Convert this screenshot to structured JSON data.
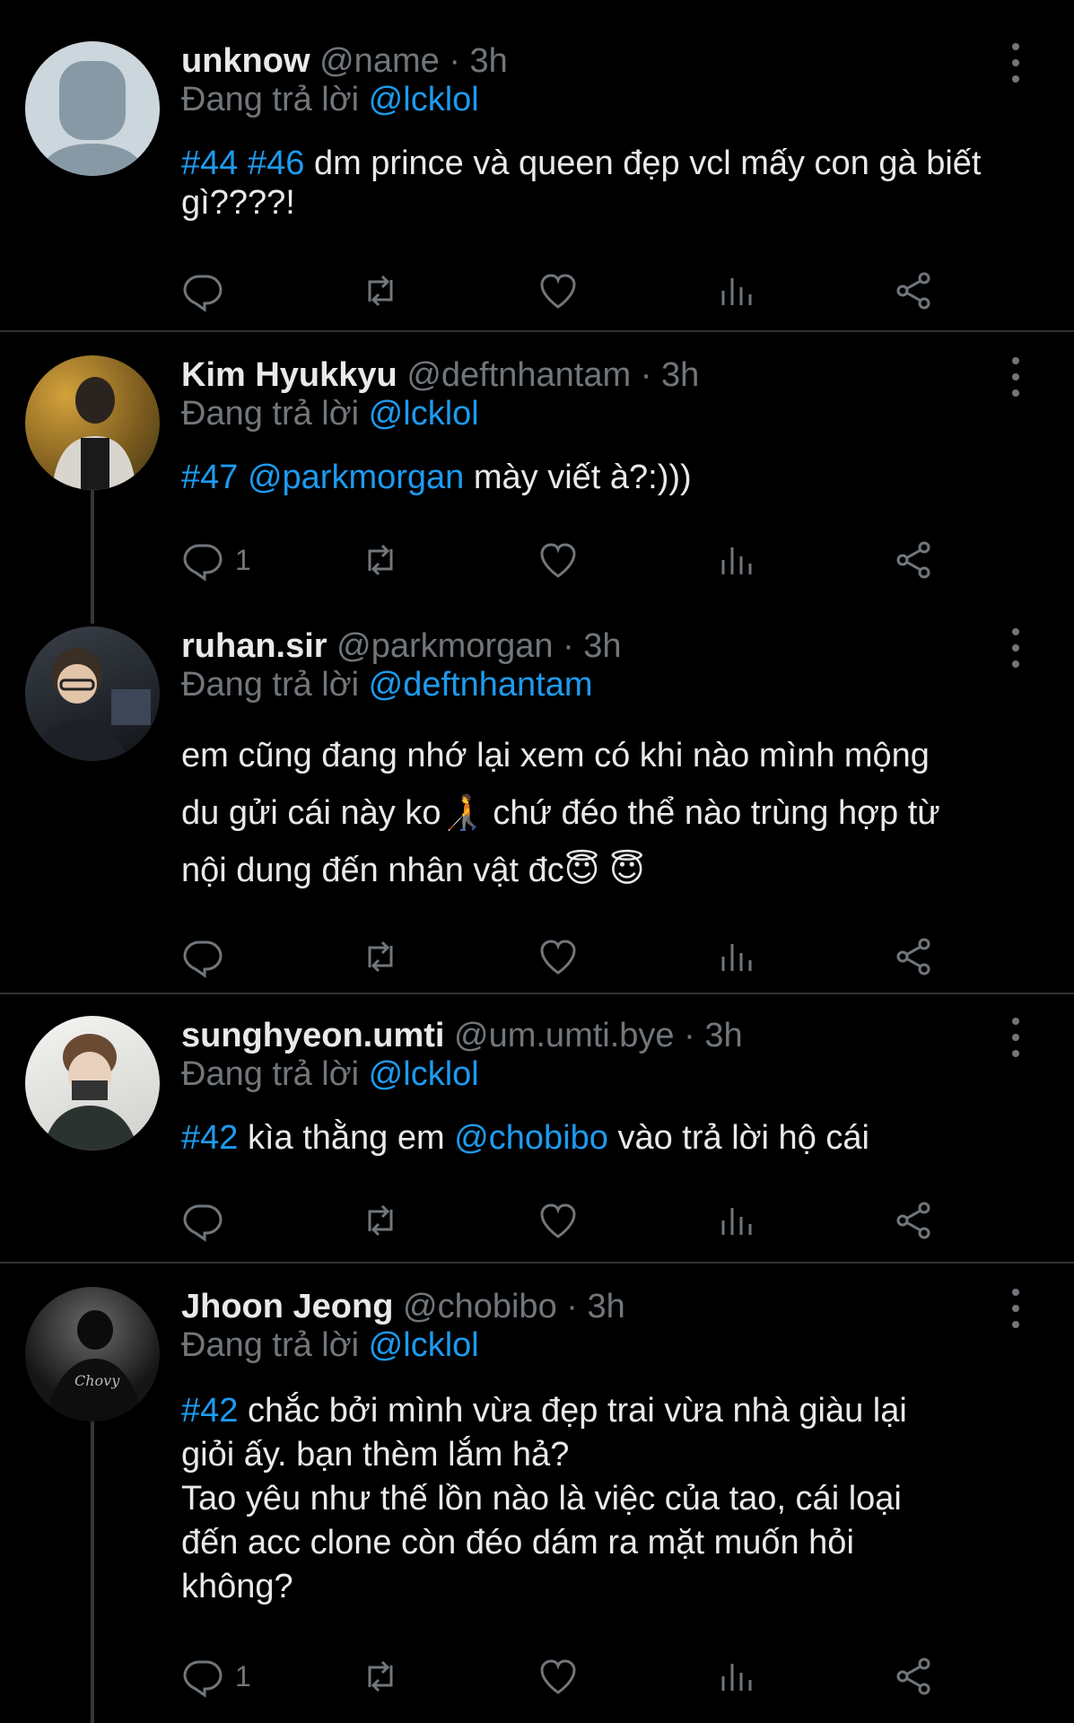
{
  "ui": {
    "replying_prefix": "Đang trả lời",
    "dot": "·"
  },
  "tweets": [
    {
      "name": "unknow",
      "handle": "@name",
      "time": "3h",
      "reply_to": "@lcklol",
      "tags": [
        "#44",
        "#46"
      ],
      "text": "dm prince và queen đẹp vcl mấy con gà biết gì????!",
      "reply_count": "",
      "avatar": "default-profile"
    },
    {
      "name": "Kim Hyukkyu",
      "handle": "@deftnhantam",
      "time": "3h",
      "reply_to": "@lcklol",
      "tags": [
        "#47"
      ],
      "mention": "@parkmorgan",
      "text": "mày viết à?:)))",
      "reply_count": "1",
      "avatar": "photo-autumn"
    },
    {
      "name": "ruhan.sir",
      "handle": "@parkmorgan",
      "time": "3h",
      "reply_to": "@deftnhantam",
      "line1": "em cũng đang nhớ lại xem có khi nào mình mộng",
      "line2": "du gửi cái này ko🧑‍🦯  chứ đéo thể nào trùng hợp từ",
      "line3": "nội dung đến nhân vật đc😇 😇",
      "reply_count": "",
      "avatar": "photo-gamer"
    },
    {
      "name": "sunghyeon.umti",
      "handle": "@um.umti.bye",
      "time": "3h",
      "reply_to": "@lcklol",
      "tags": [
        "#42"
      ],
      "pre": "kìa thằng em",
      "mention": "@chobibo",
      "post": "vào trả lời hộ cái",
      "reply_count": "",
      "avatar": "photo-mask"
    },
    {
      "name": "Jhoon Jeong",
      "handle": "@chobibo",
      "time": "3h",
      "reply_to": "@lcklol",
      "tags": [
        "#42"
      ],
      "line1": "chắc bởi mình vừa đẹp trai vừa nhà giàu lại",
      "line2": "giỏi ấy. bạn thèm lắm hả?",
      "line3": "Tao yêu như thế lồn nào là việc của tao, cái loại",
      "line4": "đến acc clone còn đéo dám ra mặt muốn hỏi",
      "line5": "không?",
      "reply_count": "1",
      "avatar": "photo-dark"
    }
  ]
}
